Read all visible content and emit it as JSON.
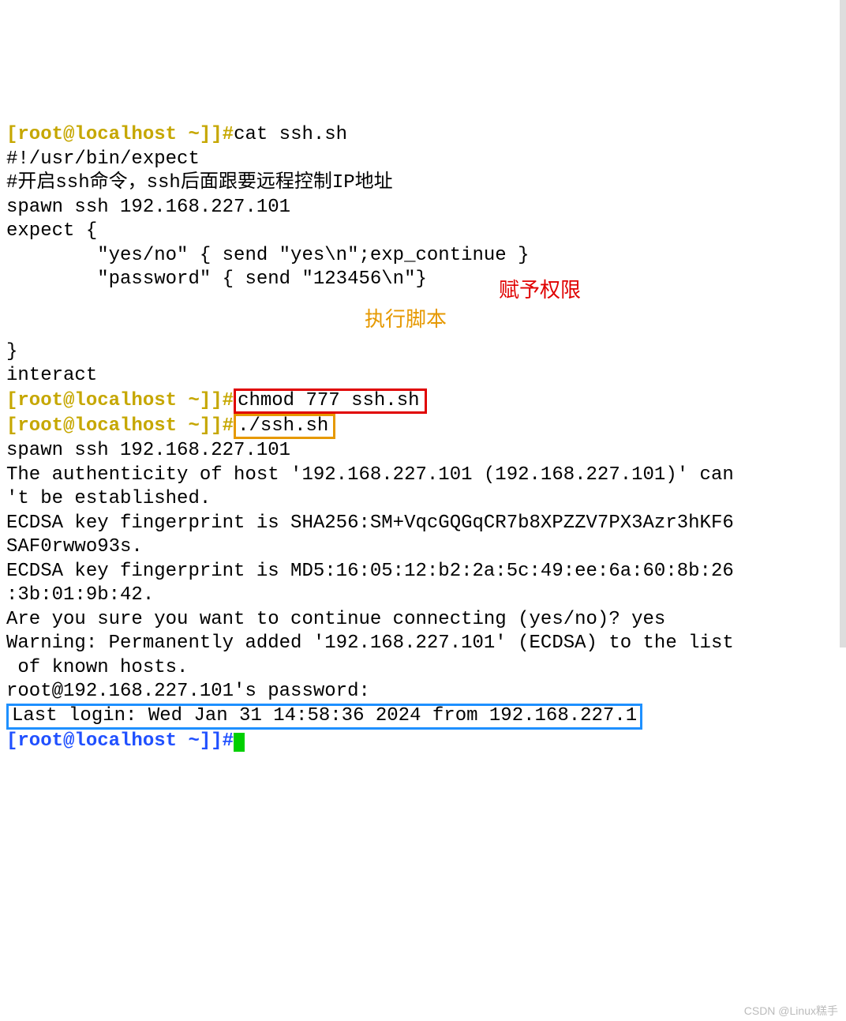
{
  "prompt": {
    "open": "[root@localhost ~]",
    "close": "]",
    "hash": "#"
  },
  "cmd1": "cat ssh.sh",
  "script": {
    "l1": "#!/usr/bin/expect",
    "l2": "#开启ssh命令，ssh后面跟要远程控制IP地址",
    "l3": "spawn ssh 192.168.227.101",
    "l4": "expect {",
    "l5": "        \"yes/no\" { send \"yes\\n\";exp_continue }",
    "l6": "        \"password\" { send \"123456\\n\"}",
    "l7": "",
    "l8": "",
    "l9": "}",
    "l10": "interact"
  },
  "cmd2": "chmod 777 ssh.sh",
  "note2": "赋予权限",
  "cmd3": "./ssh.sh",
  "note3": "执行脚本",
  "out": {
    "o1": "spawn ssh 192.168.227.101",
    "o2": "The authenticity of host '192.168.227.101 (192.168.227.101)' can",
    "o3": "'t be established.",
    "o4": "ECDSA key fingerprint is SHA256:SM+VqcGQGqCR7b8XPZZV7PX3Azr3hKF6",
    "o5": "SAF0rwwo93s.",
    "o6": "ECDSA key fingerprint is MD5:16:05:12:b2:2a:5c:49:ee:6a:60:8b:26",
    "o7": ":3b:01:9b:42.",
    "o8": "Are you sure you want to continue connecting (yes/no)? yes",
    "o9": "Warning: Permanently added '192.168.227.101' (ECDSA) to the list",
    "o10": " of known hosts.",
    "o11": "root@192.168.227.101's password:",
    "o12": "Last login: Wed Jan 31 14:58:36 2024 from 192.168.227.1"
  },
  "watermark": "CSDN @Linux糕手"
}
